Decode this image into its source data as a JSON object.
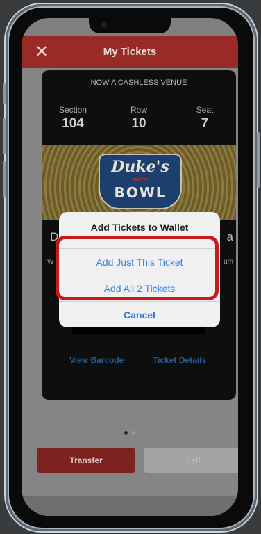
{
  "header": {
    "title": "My Tickets"
  },
  "ticket": {
    "venue_note": "NOW A CASHLESS VENUE",
    "section_label": "Section",
    "section_value": "104",
    "row_label": "Row",
    "row_value": "10",
    "seat_label": "Seat",
    "seat_value": "7",
    "event_logo": {
      "script": "Duke's",
      "sub": "MAYO",
      "main": "BOWL"
    },
    "event_name_left": "D",
    "event_name_right": "a",
    "event_info_left": "W",
    "event_info_right": "um",
    "view_barcode_label": "View Barcode",
    "ticket_details_label": "Ticket Details"
  },
  "peek_card": {
    "event_name": "D",
    "info": "W"
  },
  "pager": {
    "active_index": 0,
    "count": 2
  },
  "actions": {
    "transfer_label": "Transfer",
    "sell_label": "Sell"
  },
  "wallet_sheet": {
    "title": "Add Tickets to Wallet",
    "option_just_this": "Add Just This Ticket",
    "option_all": "Add All 2 Tickets",
    "cancel_label": "Cancel"
  },
  "colors": {
    "brand_red": "#9a2a26",
    "link_blue": "#2f86e6",
    "highlight_red": "#c8191c"
  }
}
